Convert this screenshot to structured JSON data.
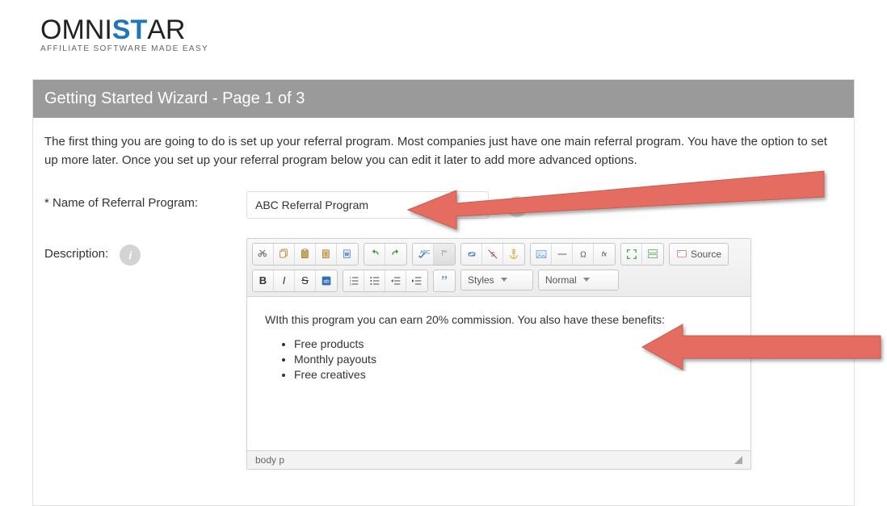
{
  "brand": {
    "name_parts": {
      "o": "O",
      "mni": "MNI",
      "st": "ST",
      "ar": "AR"
    },
    "tagline": "AFFILIATE SOFTWARE MADE EASY"
  },
  "wizard": {
    "title": "Getting Started Wizard - Page 1 of 3",
    "intro": "The first thing you are going to do is set up your referral program. Most companies just have one main referral program. You have the option to set up more later. Once you set up your referral program below you can edit it later to add more advanced options."
  },
  "fields": {
    "name_label": "* Name of Referral Program:",
    "name_value": "ABC Referral Program",
    "description_label": "Description:"
  },
  "editor": {
    "styles_label": "Styles",
    "format_label": "Normal",
    "source_label": "Source",
    "path_label": "body   p",
    "content_text": "WIth this program you can earn 20% commission. You also have these benefits:",
    "bullets": [
      "Free products",
      "Monthly payouts",
      "Free creatives"
    ]
  },
  "icons": {
    "info": "i"
  }
}
